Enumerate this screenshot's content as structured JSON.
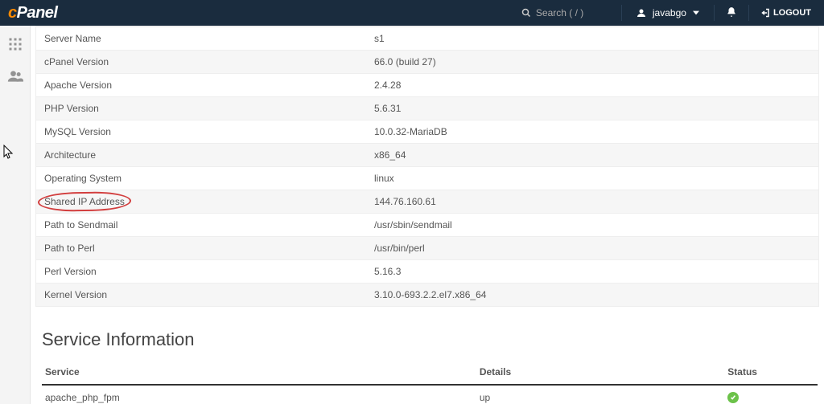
{
  "header": {
    "search_placeholder": "Search ( / )",
    "username": "javabgo",
    "logout_label": "LOGOUT"
  },
  "info_rows": [
    {
      "key": "Server Name",
      "value": "s1"
    },
    {
      "key": "cPanel Version",
      "value": "66.0 (build 27)"
    },
    {
      "key": "Apache Version",
      "value": "2.4.28"
    },
    {
      "key": "PHP Version",
      "value": "5.6.31"
    },
    {
      "key": "MySQL Version",
      "value": "10.0.32-MariaDB"
    },
    {
      "key": "Architecture",
      "value": "x86_64"
    },
    {
      "key": "Operating System",
      "value": "linux"
    },
    {
      "key": "Shared IP Address",
      "value": "144.76.160.61",
      "highlight": true
    },
    {
      "key": "Path to Sendmail",
      "value": "/usr/sbin/sendmail"
    },
    {
      "key": "Path to Perl",
      "value": "/usr/bin/perl"
    },
    {
      "key": "Perl Version",
      "value": "5.16.3"
    },
    {
      "key": "Kernel Version",
      "value": "3.10.0-693.2.2.el7.x86_64"
    }
  ],
  "service_section": {
    "title": "Service Information",
    "headers": {
      "service": "Service",
      "details": "Details",
      "status": "Status"
    },
    "rows": [
      {
        "service": "apache_php_fpm",
        "details": "up",
        "status": "ok"
      }
    ]
  }
}
